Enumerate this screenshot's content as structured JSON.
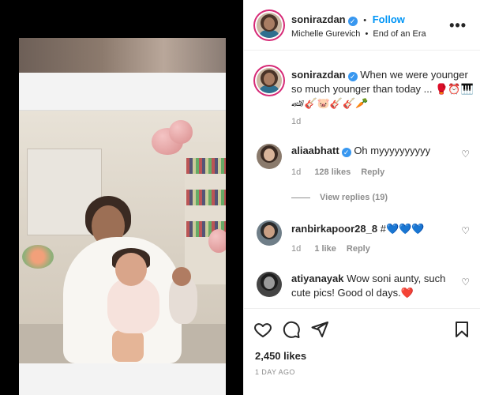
{
  "post": {
    "username": "sonirazdan",
    "follow_label": "Follow",
    "dot": "•",
    "music_artist": "Michelle Gurevich",
    "music_song": "End of an Era",
    "more_label": "•••"
  },
  "caption": {
    "username": "sonirazdan",
    "text": "When we were younger so much younger than today ...",
    "emojis_line1": "🥊⏰🎹",
    "emojis_line2": "🏎🎸🐷🎸🎸🥕",
    "age": "1d"
  },
  "comments": [
    {
      "username": "aliaabhatt",
      "verified": true,
      "text": "Oh myyyyyyyyyy",
      "age": "1d",
      "likes": "128 likes",
      "reply_label": "Reply",
      "view_replies": "View replies (19)"
    },
    {
      "username": "ranbirkapoor28_8",
      "text": "#💙💙💙",
      "age": "1d",
      "likes": "1 like",
      "reply_label": "Reply"
    },
    {
      "username": "atiyanayak",
      "text": "Wow soni aunty, such cute pics! Good ol days.❤️"
    }
  ],
  "footer": {
    "likes": "2,450 likes",
    "date": "1 DAY AGO"
  },
  "colors": {
    "accent": "#0095f6",
    "verified": "#3897f0",
    "story_ring": "#d62976"
  }
}
